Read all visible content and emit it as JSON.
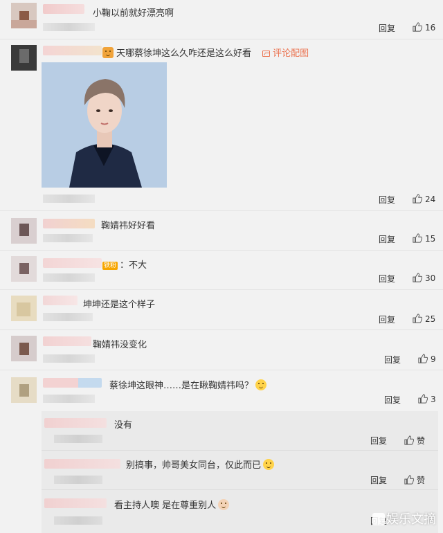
{
  "comments": [
    {
      "text": "小鞠以前就好漂亮啊",
      "reply": "回复",
      "likes": "16"
    },
    {
      "text": "天哪蔡徐坤这么久咋还是这么好看",
      "link": "评论配图",
      "reply": "回复",
      "likes": "24"
    },
    {
      "text": "鞠婧祎好好看",
      "reply": "回复",
      "likes": "15"
    },
    {
      "badge": "铁粉",
      "text": "：不大",
      "reply": "回复",
      "likes": "30"
    },
    {
      "text": "坤坤还是这个样子",
      "reply": "回复",
      "likes": "25"
    },
    {
      "text": "鞠婧祎没变化",
      "reply": "回复",
      "likes": "9"
    },
    {
      "text": "蔡徐坤这眼神……是在瞅鞠婧祎吗？",
      "reply": "回复",
      "likes": "3"
    }
  ],
  "replies": [
    {
      "text": "没有",
      "reply": "回复",
      "like_label": "赞"
    },
    {
      "text": "别搞事，帅哥美女同台，仅此而已",
      "reply": "回复",
      "like_label": "赞"
    },
    {
      "text": "看主持人噢 是在尊重别人",
      "reply": "回复",
      "like_label": "赞"
    }
  ],
  "watermark": "娱乐文摘",
  "colors": {
    "background": "#f2f2f2",
    "link": "#eb7350",
    "badge": "#f7a600"
  }
}
